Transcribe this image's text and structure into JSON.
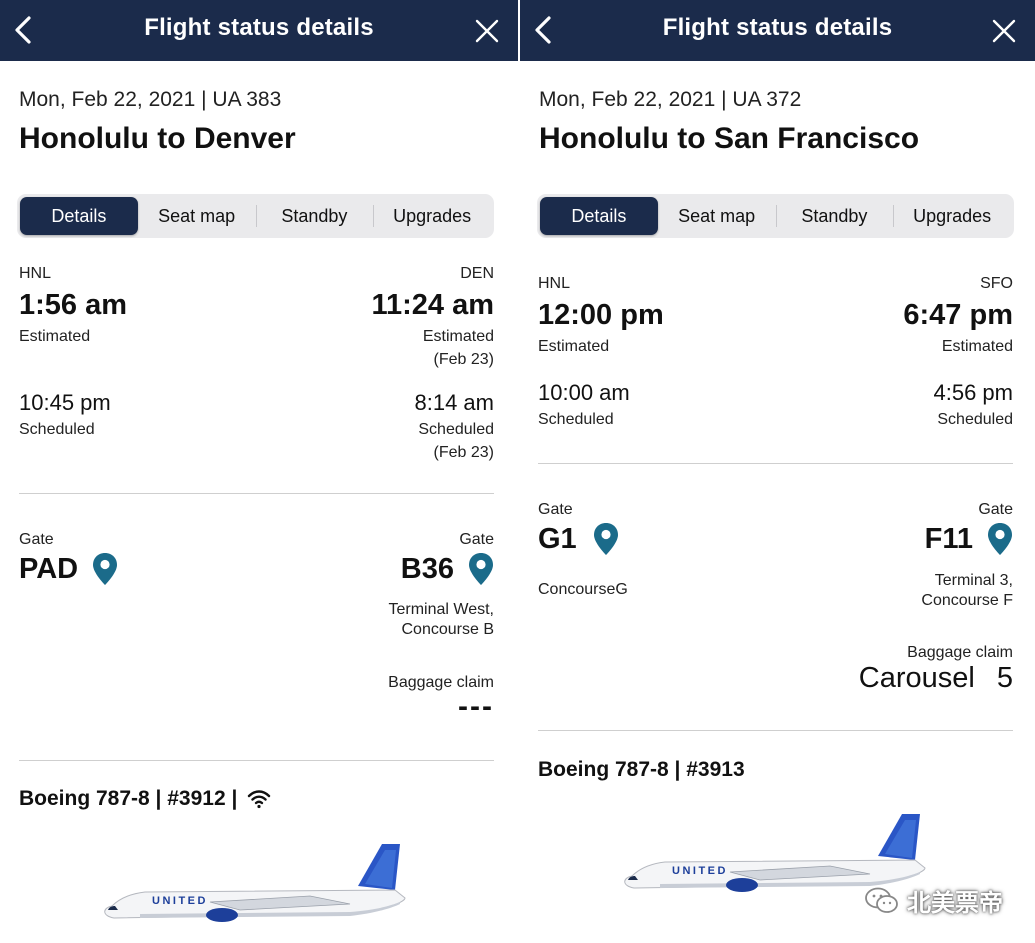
{
  "left": {
    "nav_title": "Flight status details",
    "date_flight": "Mon, Feb 22, 2021 | UA 383",
    "route": "Honolulu to Denver",
    "tabs": [
      "Details",
      "Seat map",
      "Standby",
      "Upgrades"
    ],
    "origin": {
      "code": "HNL",
      "est_time": "1:56 am",
      "est_label": "Estimated",
      "sched_time": "10:45 pm",
      "sched_label": "Scheduled"
    },
    "dest": {
      "code": "DEN",
      "est_time": "11:24 am",
      "est_label": "Estimated",
      "est_date": "(Feb 23)",
      "sched_time": "8:14 am",
      "sched_label": "Scheduled",
      "sched_date": "(Feb 23)"
    },
    "origin_gate": {
      "label": "Gate",
      "value": "PAD"
    },
    "dest_gate": {
      "label": "Gate",
      "value": "B36",
      "terminal_line1": "Terminal West,",
      "terminal_line2": "Concourse B"
    },
    "baggage": {
      "label": "Baggage claim",
      "value": "---"
    },
    "aircraft": "Boeing 787-8 | #3912 |",
    "wifi_icon": "wifi-icon"
  },
  "right": {
    "nav_title": "Flight status details",
    "date_flight": "Mon, Feb 22, 2021 | UA 372",
    "route": "Honolulu to San Francisco",
    "tabs": [
      "Details",
      "Seat map",
      "Standby",
      "Upgrades"
    ],
    "origin": {
      "code": "HNL",
      "est_time": "12:00 pm",
      "est_label": "Estimated",
      "sched_time": "10:00 am",
      "sched_label": "Scheduled"
    },
    "dest": {
      "code": "SFO",
      "est_time": "6:47 pm",
      "est_label": "Estimated",
      "sched_time": "4:56 pm",
      "sched_label": "Scheduled"
    },
    "origin_gate": {
      "label": "Gate",
      "value": "G1",
      "concourse": "ConcourseG"
    },
    "dest_gate": {
      "label": "Gate",
      "value": "F11",
      "terminal_line1": "Terminal 3,",
      "terminal_line2": "Concourse F"
    },
    "baggage": {
      "label": "Baggage claim",
      "word": "Carousel",
      "number": "5"
    },
    "aircraft": "Boeing 787-8 | #3913"
  },
  "plane_livery_text": "UNITED",
  "watermark": "北美票帝",
  "colors": {
    "navbar": "#1b2b4b",
    "pin": "#1b6b8a",
    "tail": "#2a56c6"
  }
}
